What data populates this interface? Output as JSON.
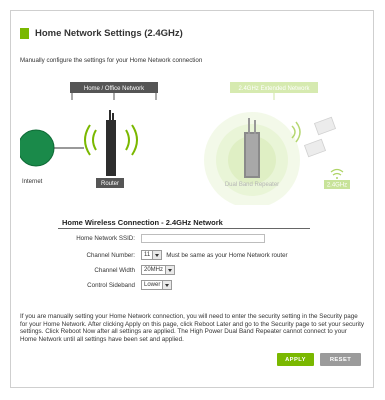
{
  "page": {
    "title": "Home Network Settings (2.4GHz)",
    "intro": "Manually configure the settings for your Home Network connection",
    "accent_color": "#7ab800"
  },
  "diagram": {
    "home_network_label": "Home / Office Network",
    "extended_network_label": "2.4GHz Extended Network",
    "internet_label": "Internet",
    "router_label": "Router",
    "repeater_label": "Dual Band Repeater",
    "band_label": "2.4GHz"
  },
  "form": {
    "section_title": "Home Wireless Connection - 2.4GHz Network",
    "ssid_label": "Home Network SSID:",
    "ssid_value": "",
    "channel_label": "Channel Number:",
    "channel_value": "11",
    "channel_note": "Must be same as your Home Network router",
    "width_label": "Channel Width",
    "width_value": "20MHz",
    "sideband_label": "Control Sideband",
    "sideband_value": "Lower"
  },
  "info_text": "If you are manually setting your Home Network connection, you will need to enter the security setting in the Security page for your Home Network. After clicking Apply on this page, click Reboot Later and go to the Security page to set your security settings. Click Reboot Now after all settings are applied. The High Power Dual Band Repeater cannot connect to your Home Network until all settings have been set and applied.",
  "buttons": {
    "apply": "APPLY",
    "reset": "RESET"
  }
}
